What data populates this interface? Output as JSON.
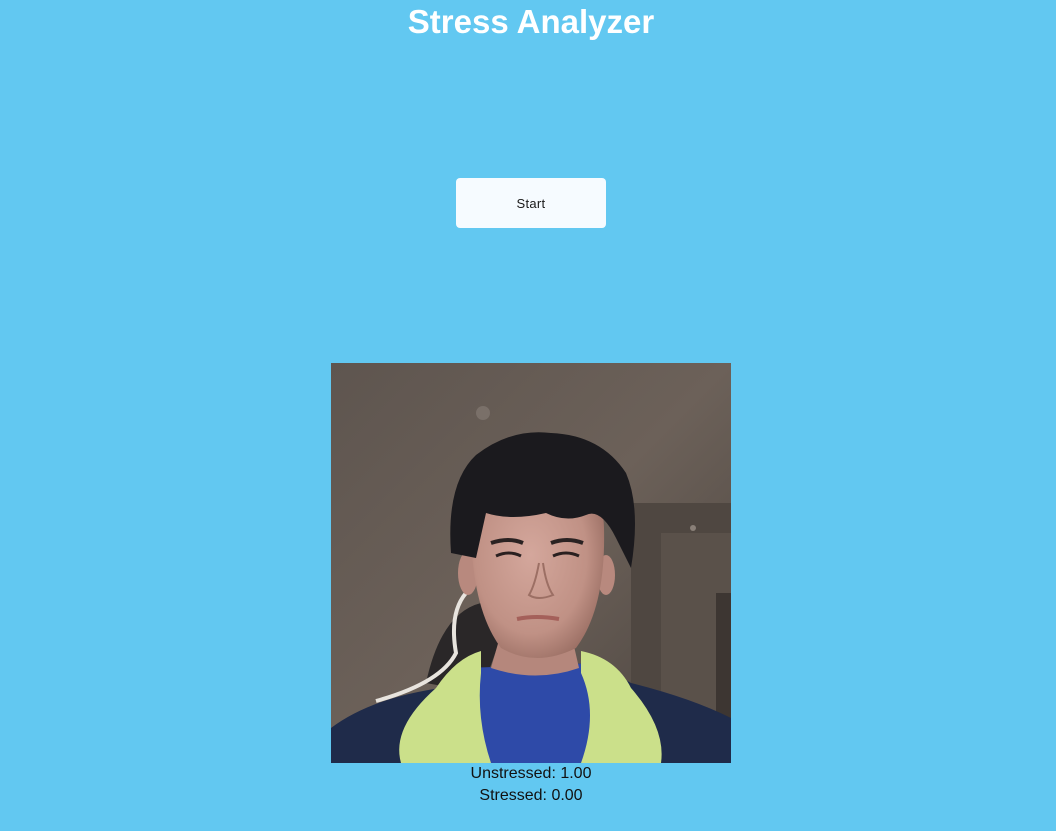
{
  "header": {
    "title": "Stress Analyzer"
  },
  "controls": {
    "start_label": "Start"
  },
  "camera": {
    "subject": "webcam-feed"
  },
  "results": {
    "unstressed_text": "Unstressed: 1.00",
    "stressed_text": "Stressed: 0.00",
    "unstressed_value": 1.0,
    "stressed_value": 0.0
  },
  "colors": {
    "background": "#62c8f1",
    "title": "#ffffff",
    "button_bg": "#f6fbff"
  }
}
